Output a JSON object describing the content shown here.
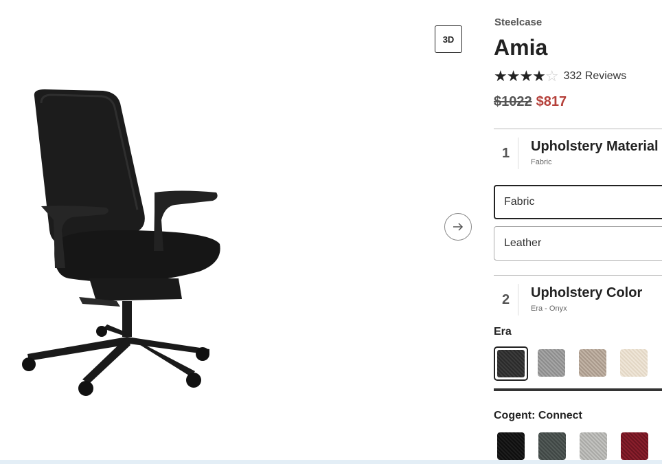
{
  "product": {
    "brand": "Steelcase",
    "name": "Amia",
    "rating": 4,
    "rating_max": 5,
    "reviews": "332 Reviews",
    "price_original": "$1022",
    "price_sale": "$817"
  },
  "viewer": {
    "btn_3d": "3D",
    "next_icon": "arrow-right-icon"
  },
  "step1": {
    "number": "1",
    "title": "Upholstery Material",
    "selected": "Fabric",
    "options": [
      "Fabric",
      "Leather"
    ]
  },
  "step2": {
    "number": "2",
    "title": "Upholstery Color",
    "selected": "Era - Onyx",
    "groups": [
      {
        "label": "Era",
        "swatches": [
          "#333333",
          "#9a9a9a",
          "#b5a698",
          "#e8ddcc"
        ],
        "selected_index": 0
      },
      {
        "label": "Cogent: Connect",
        "swatches": [
          "#151515",
          "#4a5250",
          "#b6b6b3",
          "#7a1a26"
        ]
      }
    ]
  },
  "colors": {
    "sale": "#b5403a",
    "text": "#222222"
  }
}
